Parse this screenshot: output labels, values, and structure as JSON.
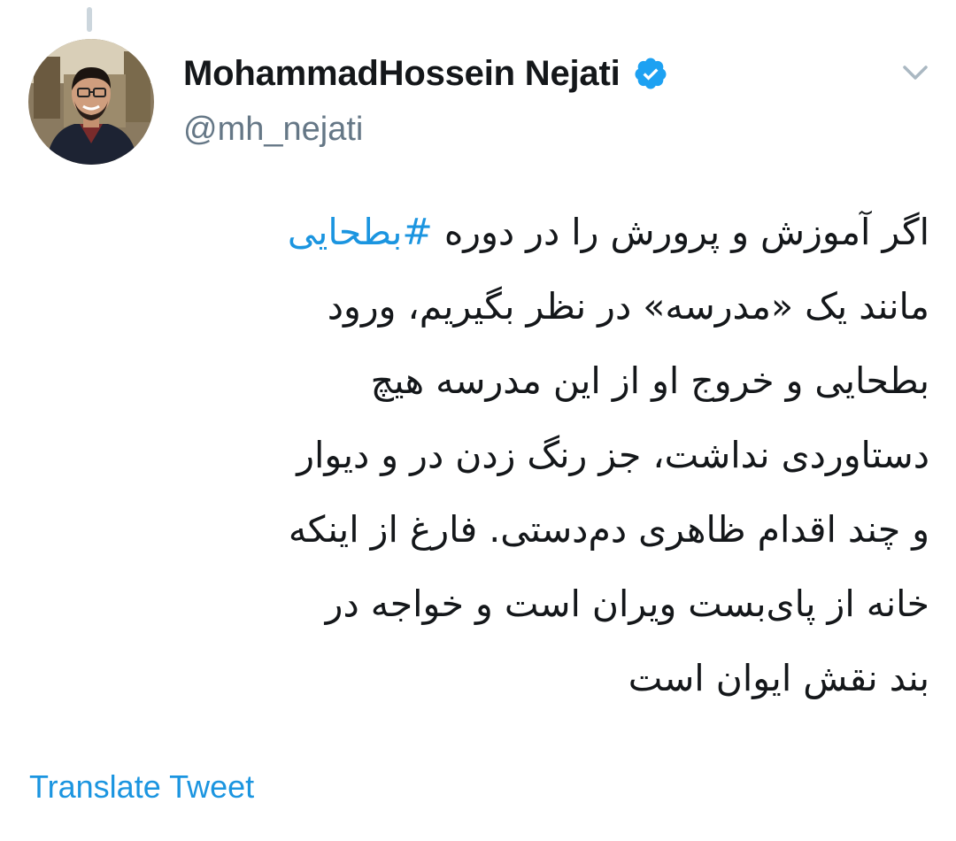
{
  "author": {
    "display_name": "MohammadHossein Nejati",
    "handle": "@mh_nejati",
    "verified": true,
    "avatar_icon": "profile-photo"
  },
  "tweet": {
    "hashtag": "#بطحایی",
    "lines": [
      "اگر آموزش و پرورش را در دوره ",
      "مانند یک «مدرسه» در نظر بگیریم، ورود",
      "بطحایی و خروج او از این مدرسه هیچ",
      "دستاوردی نداشت، جز رنگ زدن در و دیوار",
      "و چند اقدام ظاهری دم‌دستی. فارغ از اینکه",
      "خانه از پای‌بست ویران است و خواجه در",
      "بند نقش ایوان است"
    ]
  },
  "actions": {
    "translate_label": "Translate Tweet",
    "menu_icon": "chevron-down-icon"
  },
  "colors": {
    "link": "#1b95e0",
    "verified": "#1da1f2",
    "secondary_text": "#657786",
    "text": "#14171a"
  }
}
